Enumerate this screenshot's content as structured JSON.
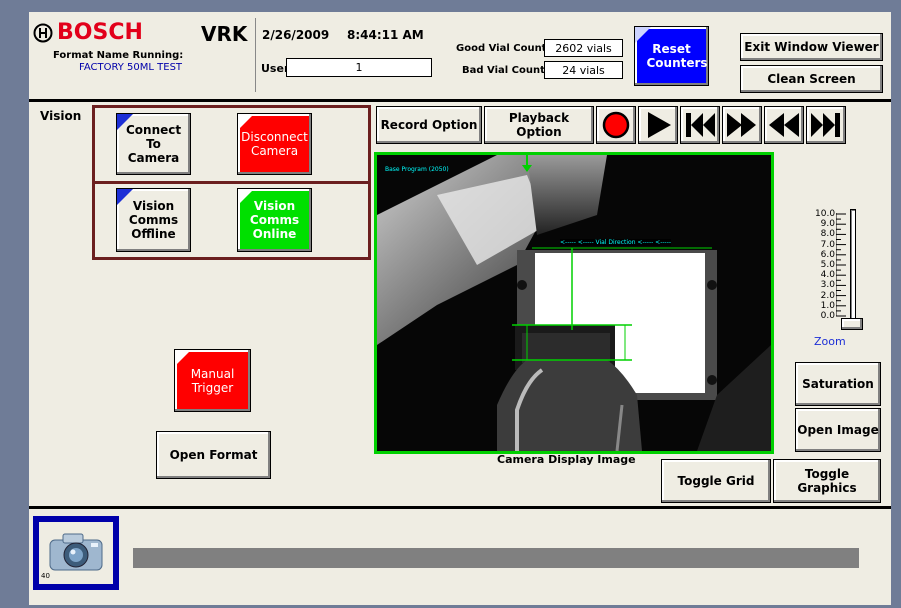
{
  "header": {
    "brand": "BOSCH",
    "product": "VRK",
    "date": "2/26/2009",
    "time": "8:44:11 AM",
    "format_label": "Format Name Running:",
    "format_value": "FACTORY 50ML TEST",
    "user_label": "User:",
    "user_value": "1",
    "good_label": "Good Vial Count",
    "good_value": "2602 vials",
    "bad_label": "Bad Vial Count",
    "bad_value": "24 vials",
    "reset_label": "Reset Counters",
    "exit_label": "Exit Window Viewer",
    "clean_label": "Clean Screen"
  },
  "vision": {
    "section_label": "Vision",
    "connect_label": "Connect To Camera",
    "disconnect_label": "Disconnect Camera",
    "comms_offline_label": "Vision Comms Offline",
    "comms_online_label": "Vision Comms Online"
  },
  "controls": {
    "manual_trigger_label": "Manual Trigger",
    "open_format_label": "Open Format",
    "record_label": "Record Option",
    "playback_label": "Playback Option"
  },
  "camera": {
    "overlay_program": "Base Program (2050)",
    "overlay_direction": "<----- <----- Vial Direction <----- <-----",
    "caption": "Camera Display Image"
  },
  "zoom": {
    "label": "Zoom",
    "ticks": [
      "10.0",
      "9.0",
      "8.0",
      "7.0",
      "6.0",
      "5.0",
      "4.0",
      "3.0",
      "2.0",
      "1.0",
      "0.0"
    ],
    "value": 0.0
  },
  "side_buttons": {
    "saturation": "Saturation",
    "open_image": "Open Image",
    "toggle_grid": "Toggle Grid",
    "toggle_graphics": "Toggle Graphics"
  },
  "bottom": {
    "camera_tile_number": "40"
  },
  "colors": {
    "red": "#ff0000",
    "green": "#00e000",
    "blue": "#0000ff",
    "corner": "#1d2fd6",
    "overlay_green": "#00d000"
  }
}
